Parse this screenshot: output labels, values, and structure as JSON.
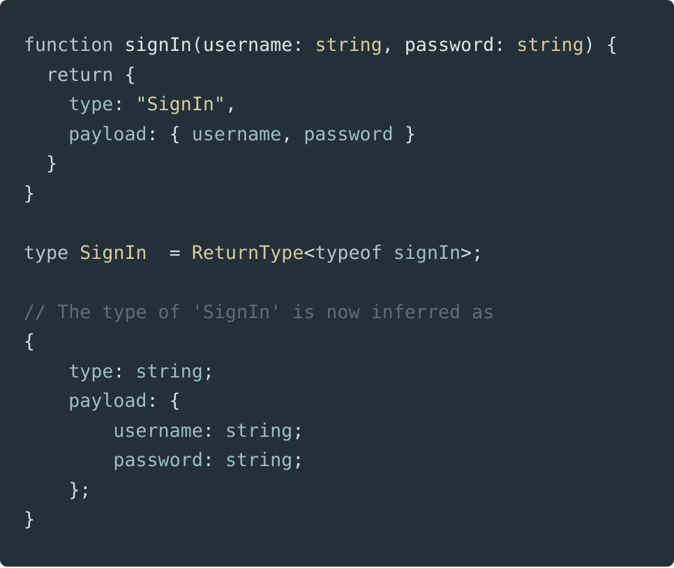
{
  "colors": {
    "background": "#243039",
    "keyword": "#b8c4cc",
    "type": "#d7cd9a",
    "property": "#9cbfc0",
    "string": "#d6cd9c",
    "comment": "#5f6c75"
  },
  "code": {
    "lines": [
      [
        {
          "k": "keyword",
          "t": "function "
        },
        {
          "k": "plain",
          "t": "signIn"
        },
        {
          "k": "punct",
          "t": "("
        },
        {
          "k": "plain",
          "t": "username"
        },
        {
          "k": "punct",
          "t": ": "
        },
        {
          "k": "type",
          "t": "string"
        },
        {
          "k": "punct",
          "t": ", "
        },
        {
          "k": "plain",
          "t": "password"
        },
        {
          "k": "punct",
          "t": ": "
        },
        {
          "k": "type",
          "t": "string"
        },
        {
          "k": "punct",
          "t": ") {"
        }
      ],
      [
        {
          "k": "keyword",
          "t": "  return "
        },
        {
          "k": "punct",
          "t": "{"
        }
      ],
      [
        {
          "k": "prop",
          "t": "    type"
        },
        {
          "k": "punct",
          "t": ": "
        },
        {
          "k": "string",
          "t": "\"SignIn\""
        },
        {
          "k": "punct",
          "t": ","
        }
      ],
      [
        {
          "k": "prop",
          "t": "    payload"
        },
        {
          "k": "punct",
          "t": ": { "
        },
        {
          "k": "prop",
          "t": "username"
        },
        {
          "k": "punct",
          "t": ", "
        },
        {
          "k": "prop",
          "t": "password"
        },
        {
          "k": "punct",
          "t": " }"
        }
      ],
      [
        {
          "k": "punct",
          "t": "  }"
        }
      ],
      [
        {
          "k": "punct",
          "t": "}"
        }
      ],
      [],
      [
        {
          "k": "keyword",
          "t": "type "
        },
        {
          "k": "type",
          "t": "SignIn"
        },
        {
          "k": "punct",
          "t": "  = "
        },
        {
          "k": "type",
          "t": "ReturnType"
        },
        {
          "k": "punct",
          "t": "<"
        },
        {
          "k": "keyword",
          "t": "typeof "
        },
        {
          "k": "prop",
          "t": "signIn"
        },
        {
          "k": "punct",
          "t": ">;"
        }
      ],
      [],
      [
        {
          "k": "comment",
          "t": "// The type of 'SignIn' is now inferred as"
        }
      ],
      [
        {
          "k": "punct",
          "t": "{"
        }
      ],
      [
        {
          "k": "prop",
          "t": "    type"
        },
        {
          "k": "punct",
          "t": ": "
        },
        {
          "k": "prop",
          "t": "string"
        },
        {
          "k": "punct",
          "t": ";"
        }
      ],
      [
        {
          "k": "prop",
          "t": "    payload"
        },
        {
          "k": "punct",
          "t": ": {"
        }
      ],
      [
        {
          "k": "prop",
          "t": "        username"
        },
        {
          "k": "punct",
          "t": ": "
        },
        {
          "k": "prop",
          "t": "string"
        },
        {
          "k": "punct",
          "t": ";"
        }
      ],
      [
        {
          "k": "prop",
          "t": "        password"
        },
        {
          "k": "punct",
          "t": ": "
        },
        {
          "k": "prop",
          "t": "string"
        },
        {
          "k": "punct",
          "t": ";"
        }
      ],
      [
        {
          "k": "punct",
          "t": "    };"
        }
      ],
      [
        {
          "k": "punct",
          "t": "}"
        }
      ]
    ]
  }
}
